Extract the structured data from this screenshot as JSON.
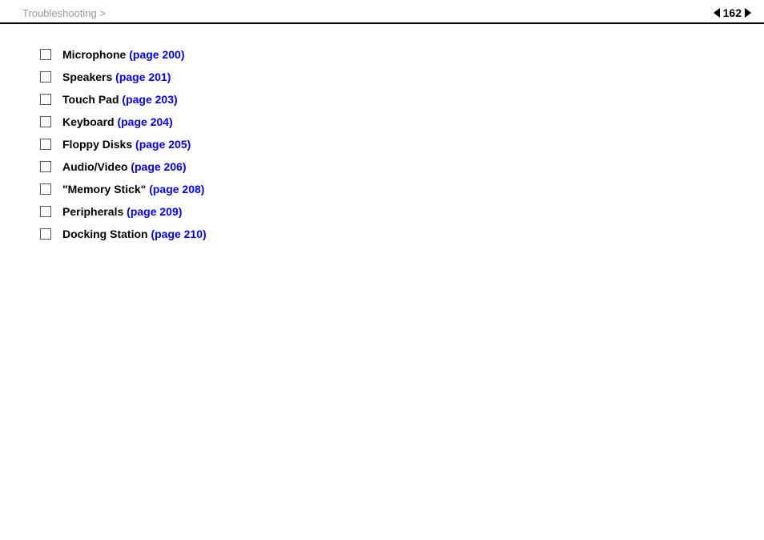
{
  "header": {
    "breadcrumb": "Troubleshooting >",
    "page_number": "162",
    "arrow_symbol": "►"
  },
  "content": {
    "items": [
      {
        "id": 1,
        "label": "Microphone",
        "link_text": "(page 200)",
        "page": "200"
      },
      {
        "id": 2,
        "label": "Speakers",
        "link_text": "(page 201)",
        "page": "201"
      },
      {
        "id": 3,
        "label": "Touch Pad",
        "link_text": "(page 203)",
        "page": "203"
      },
      {
        "id": 4,
        "label": "Keyboard",
        "link_text": "(page 204)",
        "page": "204"
      },
      {
        "id": 5,
        "label": "Floppy Disks",
        "link_text": "(page 205)",
        "page": "205"
      },
      {
        "id": 6,
        "label": "Audio/Video",
        "link_text": "(page 206)",
        "page": "206"
      },
      {
        "id": 7,
        "label": "\"Memory Stick\"",
        "link_text": "(page 208)",
        "page": "208"
      },
      {
        "id": 8,
        "label": "Peripherals",
        "link_text": "(page 209)",
        "page": "209"
      },
      {
        "id": 9,
        "label": "Docking Station",
        "link_text": "(page 210)",
        "page": "210"
      }
    ]
  },
  "colors": {
    "link": "#0000ff",
    "text": "#000000",
    "breadcrumb": "#999999",
    "border": "#000000"
  }
}
